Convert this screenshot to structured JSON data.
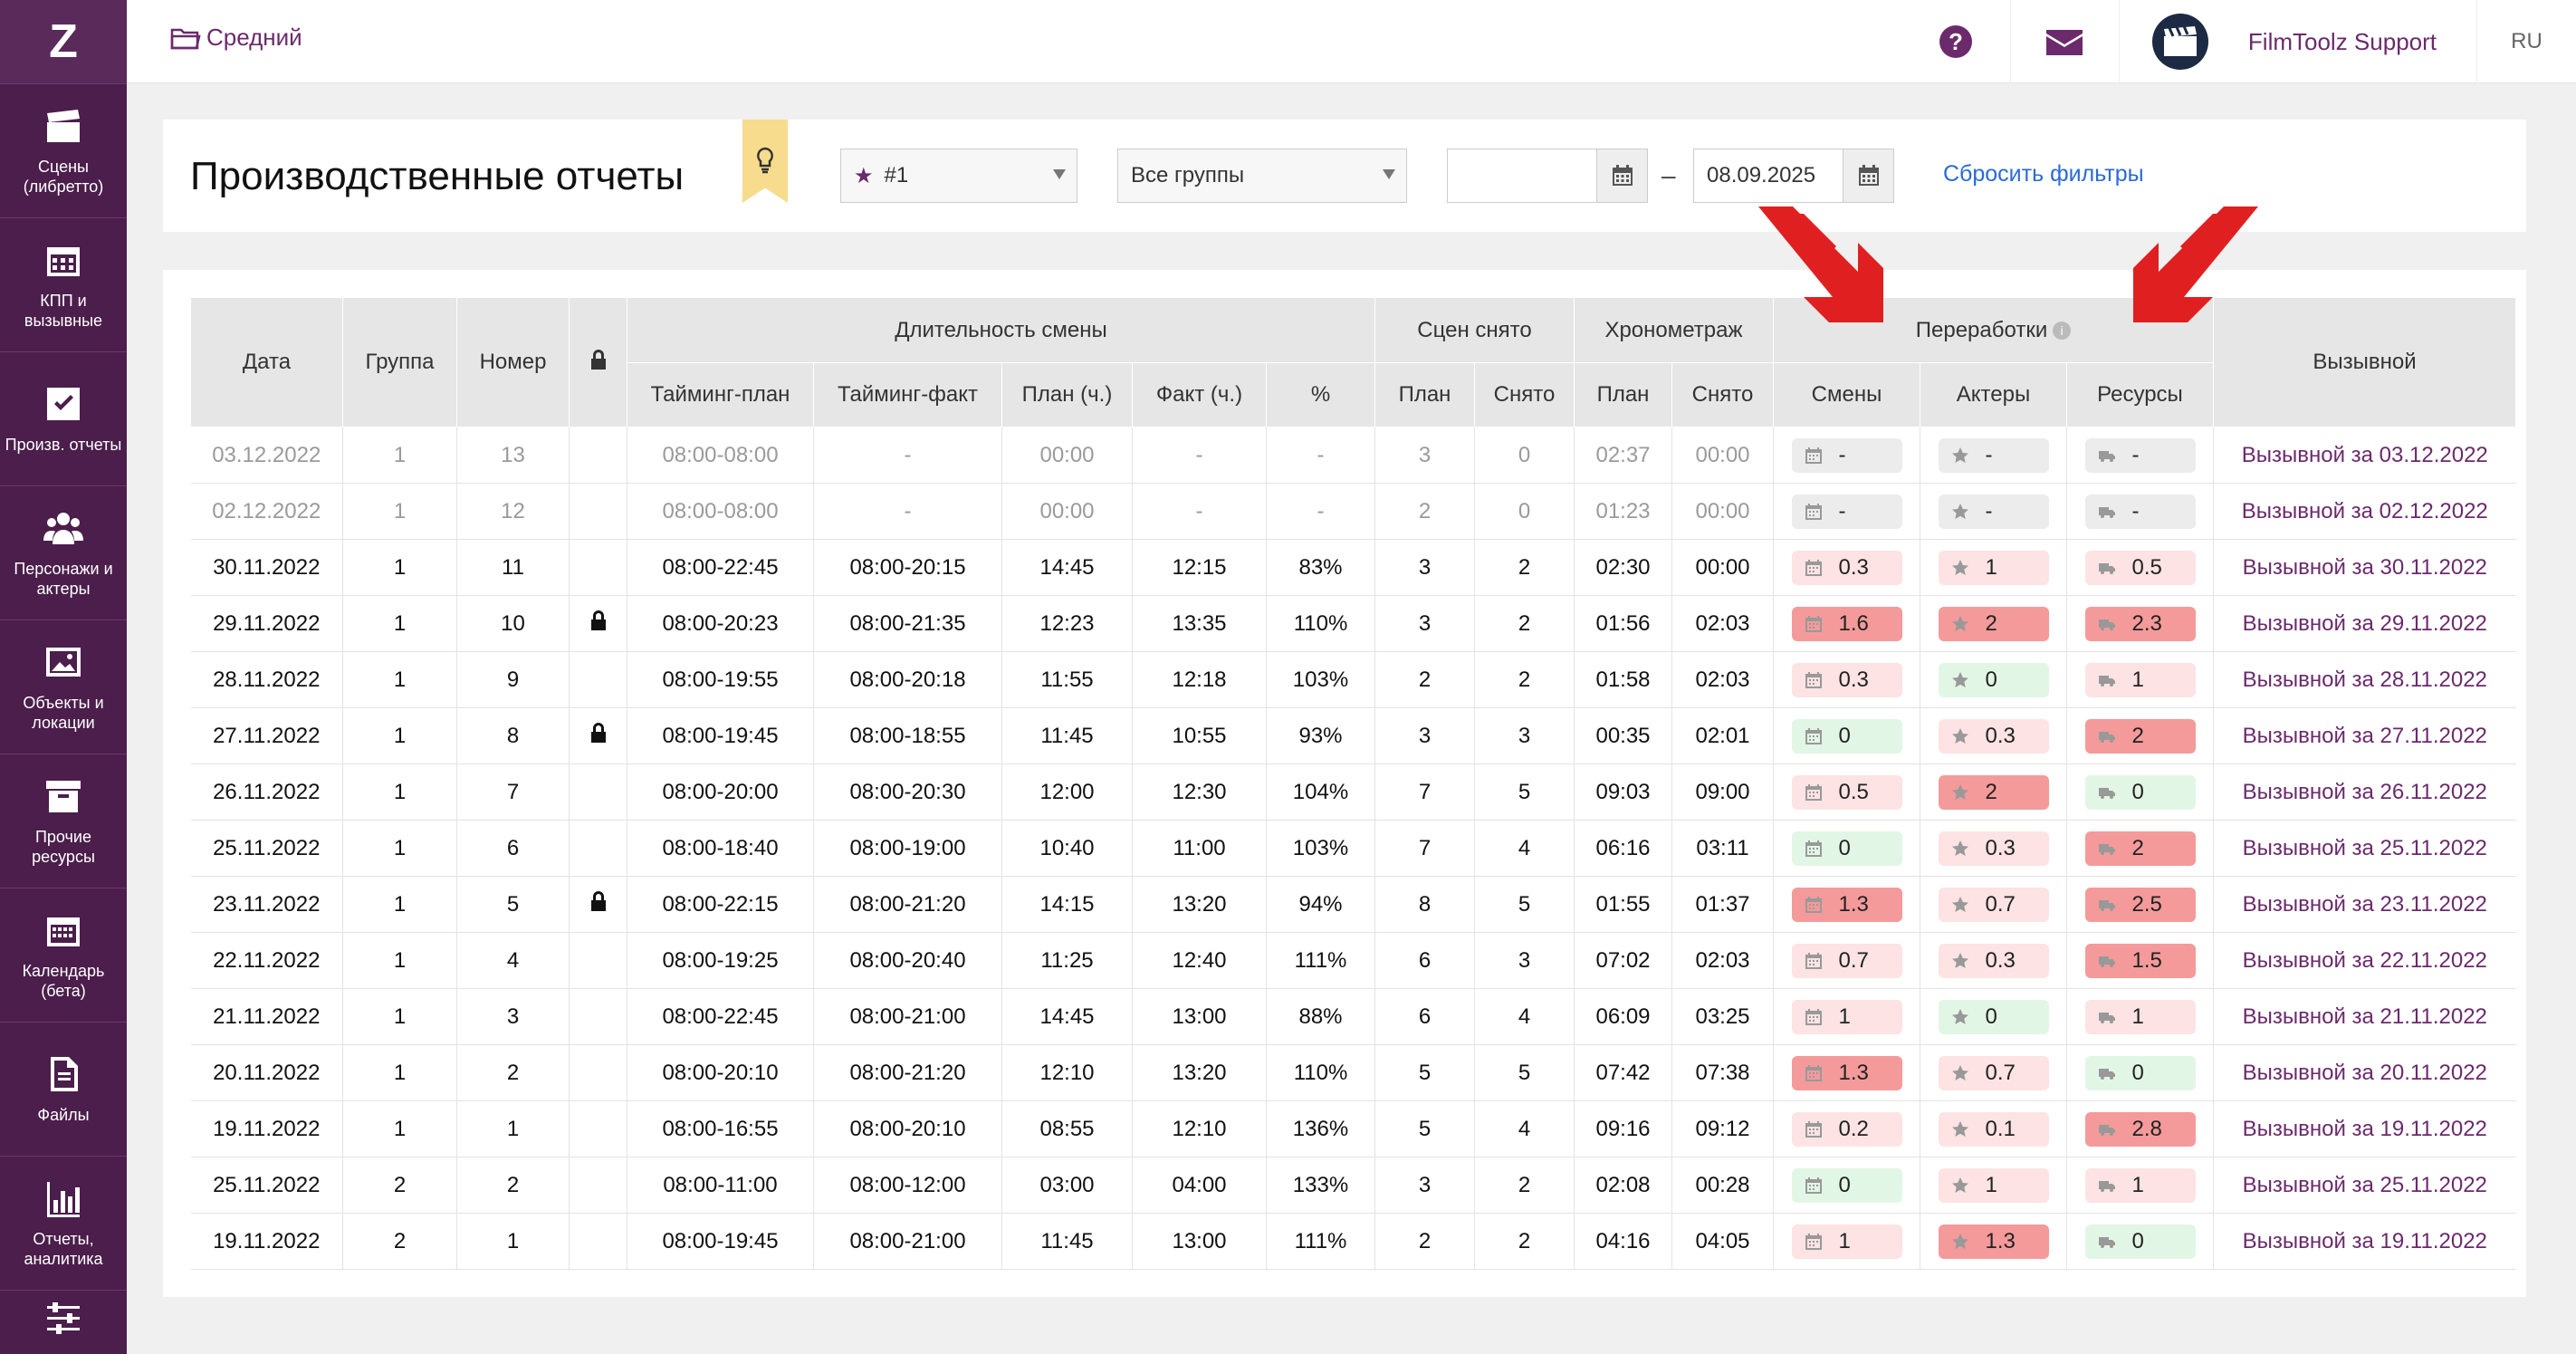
{
  "sidebar": {
    "logo": "Z",
    "items": [
      {
        "label": "Сцены\n(либретто)",
        "icon": "clapperboard-icon"
      },
      {
        "label": "КПП и\nвызывные",
        "icon": "calendar-icon"
      },
      {
        "label": "Произв. отчеты",
        "icon": "checkbox-icon"
      },
      {
        "label": "Персонажи и\nактеры",
        "icon": "people-icon"
      },
      {
        "label": "Объекты и\nлокации",
        "icon": "image-icon"
      },
      {
        "label": "Прочие\nресурсы",
        "icon": "box-icon"
      },
      {
        "label": "Календарь\n(бета)",
        "icon": "calendar-grid-icon"
      },
      {
        "label": "Файлы",
        "icon": "file-icon"
      },
      {
        "label": "Отчеты,\nаналитика",
        "icon": "bar-chart-icon"
      },
      {
        "label": "",
        "icon": "sliders-icon"
      }
    ]
  },
  "topbar": {
    "breadcrumb": "Средний",
    "help": "?",
    "support_name": "FilmToolz Support",
    "lang": "RU"
  },
  "filters": {
    "title": "Производственные отчеты",
    "project_select": "#1",
    "group_select": "Все группы",
    "date_from": "",
    "date_to": "08.09.2025",
    "dash": "–",
    "reset": "Сбросить фильтры"
  },
  "table": {
    "headers_top": {
      "date": "Дата",
      "group": "Группа",
      "number": "Номер",
      "duration": "Длительность смены",
      "scenes": "Сцен снято",
      "timing": "Хронометраж",
      "overtime": "Переработки",
      "info": "i",
      "call": "Вызывной"
    },
    "headers_sub": [
      "Тайминг-план",
      "Тайминг-факт",
      "План (ч.)",
      "Факт (ч.)",
      "%",
      "План",
      "Снято",
      "План",
      "Снято",
      "Смены",
      "Актеры",
      "Ресурсы"
    ],
    "rows": [
      {
        "dim": true,
        "cells": [
          "03.12.2022",
          "1",
          "13",
          "",
          "08:00-08:00",
          "-",
          "00:00",
          "-",
          "-",
          "3",
          "0",
          "02:37",
          "00:00"
        ],
        "ot": [
          [
            "-",
            "gray"
          ],
          [
            "-",
            "gray"
          ],
          [
            "-",
            "gray"
          ]
        ],
        "call": "Вызывной за 03.12.2022"
      },
      {
        "dim": true,
        "cells": [
          "02.12.2022",
          "1",
          "12",
          "",
          "08:00-08:00",
          "-",
          "00:00",
          "-",
          "-",
          "2",
          "0",
          "01:23",
          "00:00"
        ],
        "ot": [
          [
            "-",
            "gray"
          ],
          [
            "-",
            "gray"
          ],
          [
            "-",
            "gray"
          ]
        ],
        "call": "Вызывной за 02.12.2022"
      },
      {
        "dim": false,
        "cells": [
          "30.11.2022",
          "1",
          "11",
          "",
          "08:00-22:45",
          "08:00-20:15",
          "14:45",
          "12:15",
          "83%",
          "3",
          "2",
          "02:30",
          "00:00"
        ],
        "ot": [
          [
            "0.3",
            "pink"
          ],
          [
            "1",
            "pink"
          ],
          [
            "0.5",
            "pink"
          ]
        ],
        "call": "Вызывной за 30.11.2022"
      },
      {
        "dim": false,
        "cells": [
          "29.11.2022",
          "1",
          "10",
          "lock",
          "08:00-20:23",
          "08:00-21:35",
          "12:23",
          "13:35",
          "110%",
          "3",
          "2",
          "01:56",
          "02:03"
        ],
        "ot": [
          [
            "1.6",
            "red"
          ],
          [
            "2",
            "red"
          ],
          [
            "2.3",
            "red"
          ]
        ],
        "call": "Вызывной за 29.11.2022"
      },
      {
        "dim": false,
        "cells": [
          "28.11.2022",
          "1",
          "9",
          "",
          "08:00-19:55",
          "08:00-20:18",
          "11:55",
          "12:18",
          "103%",
          "2",
          "2",
          "01:58",
          "02:03"
        ],
        "ot": [
          [
            "0.3",
            "pink"
          ],
          [
            "0",
            "green"
          ],
          [
            "1",
            "pink"
          ]
        ],
        "call": "Вызывной за 28.11.2022"
      },
      {
        "dim": false,
        "cells": [
          "27.11.2022",
          "1",
          "8",
          "lock",
          "08:00-19:45",
          "08:00-18:55",
          "11:45",
          "10:55",
          "93%",
          "3",
          "3",
          "00:35",
          "02:01"
        ],
        "ot": [
          [
            "0",
            "green"
          ],
          [
            "0.3",
            "pink"
          ],
          [
            "2",
            "red"
          ]
        ],
        "call": "Вызывной за 27.11.2022"
      },
      {
        "dim": false,
        "cells": [
          "26.11.2022",
          "1",
          "7",
          "",
          "08:00-20:00",
          "08:00-20:30",
          "12:00",
          "12:30",
          "104%",
          "7",
          "5",
          "09:03",
          "09:00"
        ],
        "ot": [
          [
            "0.5",
            "pink"
          ],
          [
            "2",
            "red"
          ],
          [
            "0",
            "green"
          ]
        ],
        "call": "Вызывной за 26.11.2022"
      },
      {
        "dim": false,
        "cells": [
          "25.11.2022",
          "1",
          "6",
          "",
          "08:00-18:40",
          "08:00-19:00",
          "10:40",
          "11:00",
          "103%",
          "7",
          "4",
          "06:16",
          "03:11"
        ],
        "ot": [
          [
            "0",
            "green"
          ],
          [
            "0.3",
            "pink"
          ],
          [
            "2",
            "red"
          ]
        ],
        "call": "Вызывной за 25.11.2022"
      },
      {
        "dim": false,
        "cells": [
          "23.11.2022",
          "1",
          "5",
          "lock",
          "08:00-22:15",
          "08:00-21:20",
          "14:15",
          "13:20",
          "94%",
          "8",
          "5",
          "01:55",
          "01:37"
        ],
        "ot": [
          [
            "1.3",
            "red"
          ],
          [
            "0.7",
            "pink"
          ],
          [
            "2.5",
            "red"
          ]
        ],
        "call": "Вызывной за 23.11.2022"
      },
      {
        "dim": false,
        "cells": [
          "22.11.2022",
          "1",
          "4",
          "",
          "08:00-19:25",
          "08:00-20:40",
          "11:25",
          "12:40",
          "111%",
          "6",
          "3",
          "07:02",
          "02:03"
        ],
        "ot": [
          [
            "0.7",
            "pink"
          ],
          [
            "0.3",
            "pink"
          ],
          [
            "1.5",
            "red"
          ]
        ],
        "call": "Вызывной за 22.11.2022"
      },
      {
        "dim": false,
        "cells": [
          "21.11.2022",
          "1",
          "3",
          "",
          "08:00-22:45",
          "08:00-21:00",
          "14:45",
          "13:00",
          "88%",
          "6",
          "4",
          "06:09",
          "03:25"
        ],
        "ot": [
          [
            "1",
            "pink"
          ],
          [
            "0",
            "green"
          ],
          [
            "1",
            "pink"
          ]
        ],
        "call": "Вызывной за 21.11.2022"
      },
      {
        "dim": false,
        "cells": [
          "20.11.2022",
          "1",
          "2",
          "",
          "08:00-20:10",
          "08:00-21:20",
          "12:10",
          "13:20",
          "110%",
          "5",
          "5",
          "07:42",
          "07:38"
        ],
        "ot": [
          [
            "1.3",
            "red"
          ],
          [
            "0.7",
            "pink"
          ],
          [
            "0",
            "green"
          ]
        ],
        "call": "Вызывной за 20.11.2022"
      },
      {
        "dim": false,
        "cells": [
          "19.11.2022",
          "1",
          "1",
          "",
          "08:00-16:55",
          "08:00-20:10",
          "08:55",
          "12:10",
          "136%",
          "5",
          "4",
          "09:16",
          "09:12"
        ],
        "ot": [
          [
            "0.2",
            "pink"
          ],
          [
            "0.1",
            "pink"
          ],
          [
            "2.8",
            "red"
          ]
        ],
        "call": "Вызывной за 19.11.2022"
      },
      {
        "dim": false,
        "cells": [
          "25.11.2022",
          "2",
          "2",
          "",
          "08:00-11:00",
          "08:00-12:00",
          "03:00",
          "04:00",
          "133%",
          "3",
          "2",
          "02:08",
          "00:28"
        ],
        "ot": [
          [
            "0",
            "green"
          ],
          [
            "1",
            "pink"
          ],
          [
            "1",
            "pink"
          ]
        ],
        "call": "Вызывной за 25.11.2022"
      },
      {
        "dim": false,
        "cells": [
          "19.11.2022",
          "2",
          "1",
          "",
          "08:00-19:45",
          "08:00-21:00",
          "11:45",
          "13:00",
          "111%",
          "2",
          "2",
          "04:16",
          "04:05"
        ],
        "ot": [
          [
            "1",
            "pink"
          ],
          [
            "1.3",
            "red"
          ],
          [
            "0",
            "green"
          ]
        ],
        "call": "Вызывной за 19.11.2022"
      }
    ]
  },
  "colors": {
    "sidebar": "#4b1e4b",
    "accent": "#6b2a6b",
    "link": "#2a6ad8",
    "pill_gray": "#ececec",
    "pill_pink": "#fde3e3",
    "pill_red": "#f59a9a",
    "pill_green": "#e2f6e5",
    "arrow": "#e02020"
  }
}
